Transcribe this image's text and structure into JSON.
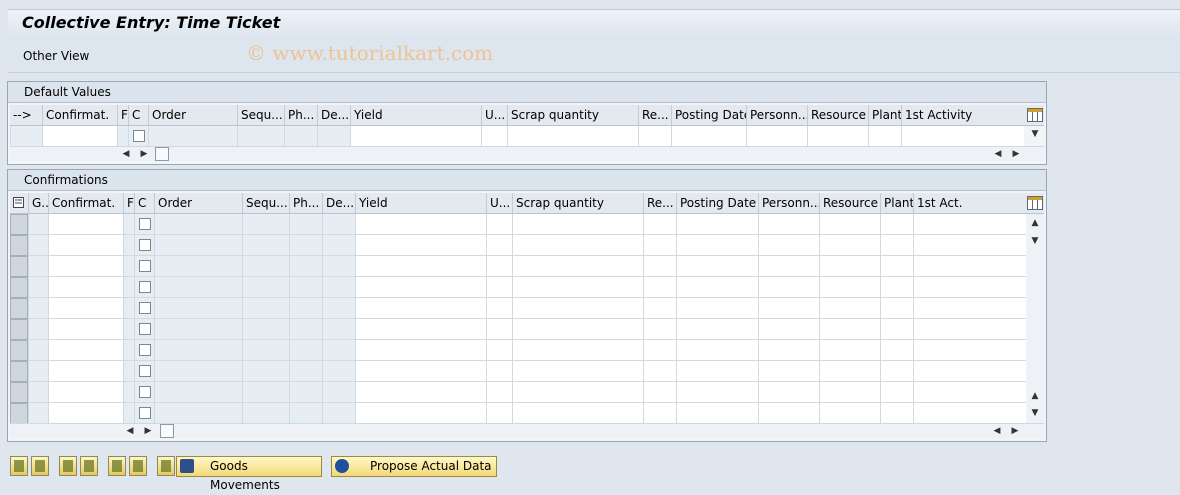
{
  "title": "Collective Entry: Time Ticket",
  "menu": {
    "other_view": "Other View"
  },
  "watermark": "© www.tutorialkart.com",
  "default_values": {
    "panel_title": "Default Values",
    "columns": [
      "-->",
      "Confirmat.",
      "F",
      "C",
      "Order",
      "Sequ...",
      "Ph...",
      "De...",
      "Yield",
      "U...",
      "Scrap quantity",
      "Re...",
      "Posting Date",
      "Personn...",
      "Resource",
      "Plant",
      "1st Activity"
    ]
  },
  "confirmations": {
    "panel_title": "Confirmations",
    "columns": [
      "",
      "G..",
      "Confirmat.",
      "F",
      "C",
      "Order",
      "Sequ...",
      "Ph...",
      "De...",
      "Yield",
      "U...",
      "Scrap quantity",
      "Re...",
      "Posting Date",
      "Personn...",
      "Resource",
      "Plant",
      "1st Act."
    ],
    "row_count": 10
  },
  "toolbar": {
    "goods_movements": "Goods Movements",
    "propose_actual_data": "Propose Actual Data"
  },
  "colors": {
    "accent_button": "#f3d878",
    "background": "#dfe6ee",
    "header": "#e3e9ef"
  }
}
